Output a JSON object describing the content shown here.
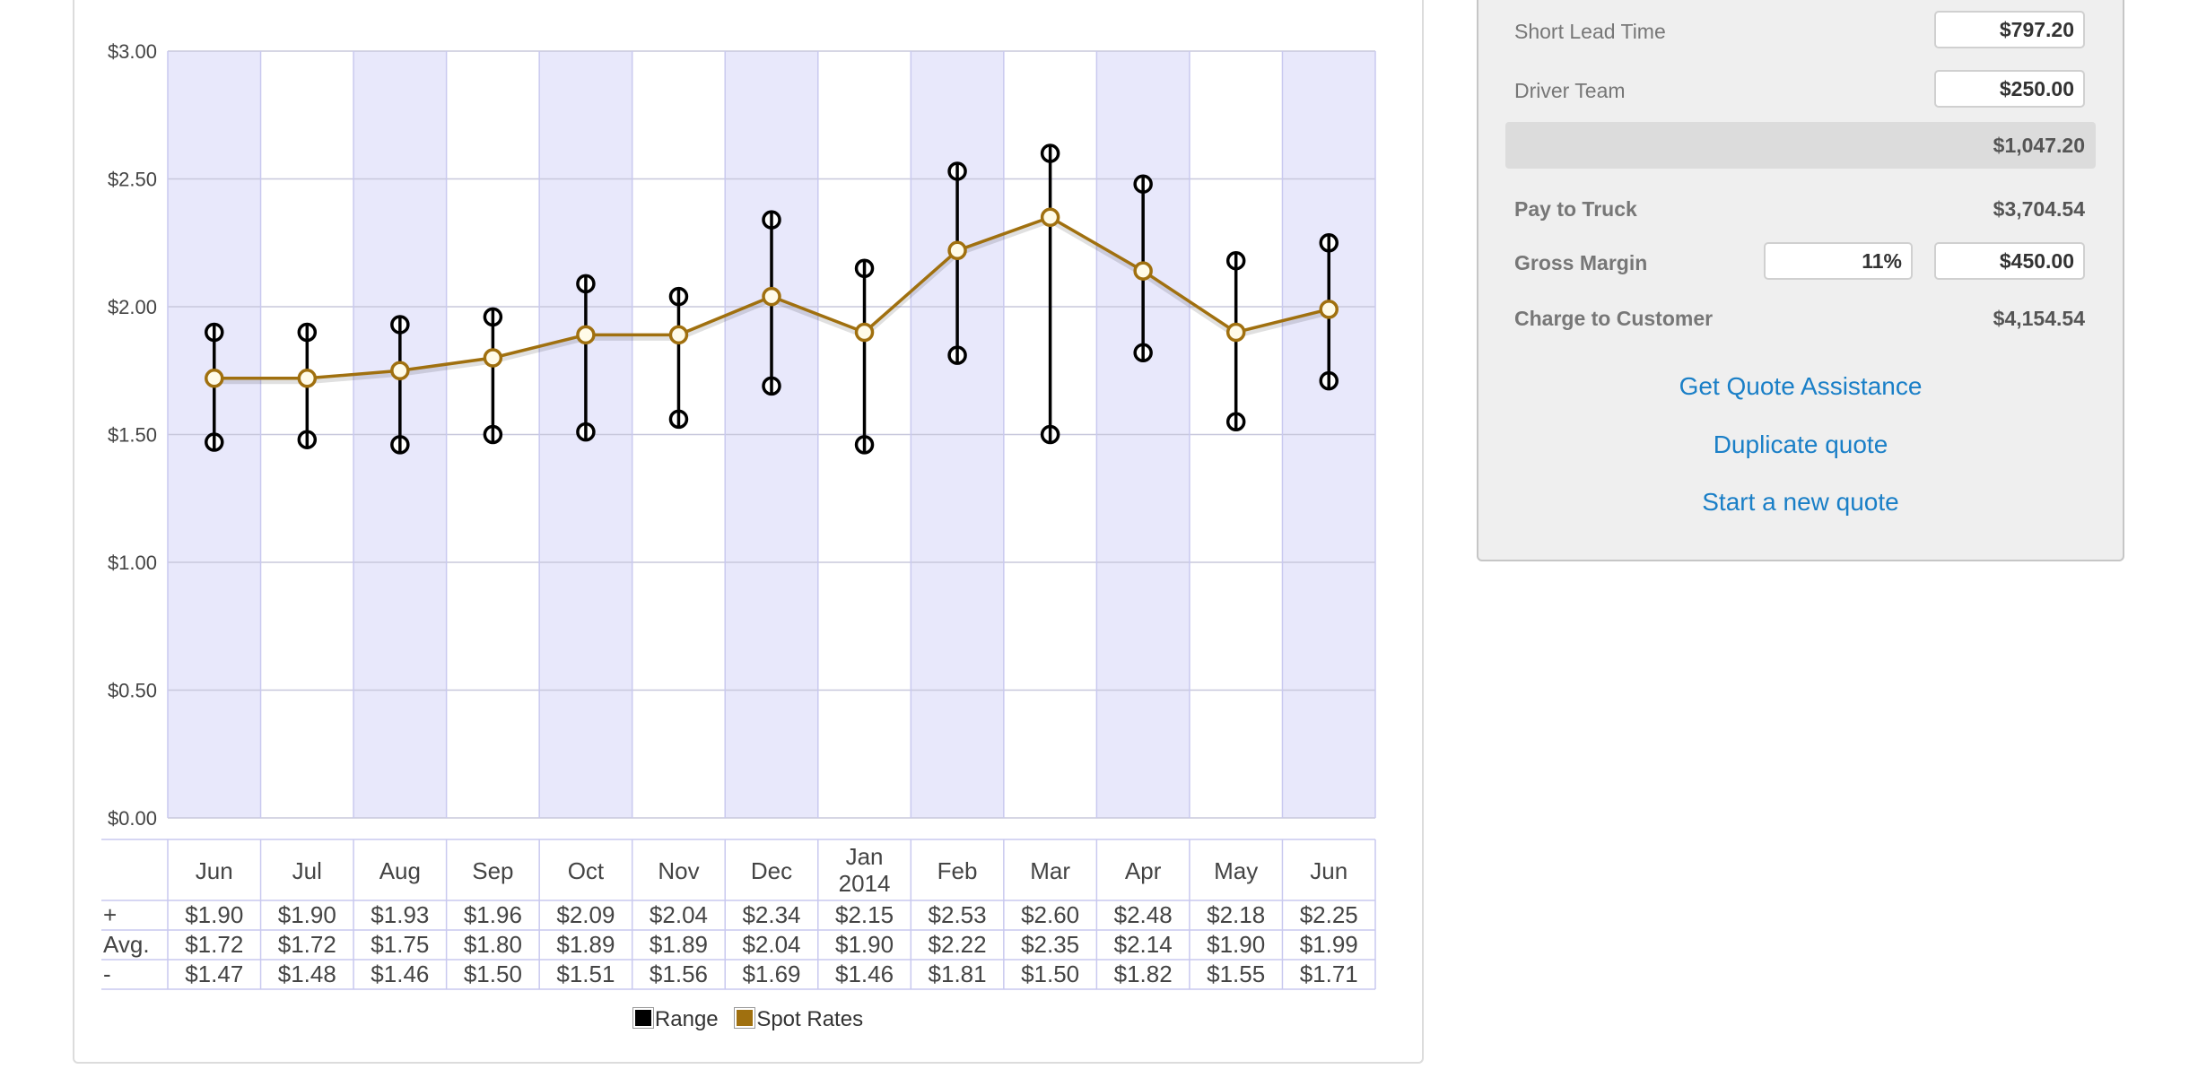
{
  "chart_data": {
    "type": "line",
    "categories": [
      "Jun",
      "Jul",
      "Aug",
      "Sep",
      "Oct",
      "Nov",
      "Dec",
      "Jan 2014",
      "Feb",
      "Mar",
      "Apr",
      "May",
      "Jun"
    ],
    "series": [
      {
        "name": "Range",
        "high": [
          1.9,
          1.9,
          1.93,
          1.96,
          2.09,
          2.04,
          2.34,
          2.15,
          2.53,
          2.6,
          2.48,
          2.18,
          2.25
        ],
        "low": [
          1.47,
          1.48,
          1.46,
          1.5,
          1.51,
          1.56,
          1.69,
          1.46,
          1.81,
          1.5,
          1.82,
          1.55,
          1.71
        ]
      },
      {
        "name": "Spot Rates",
        "values": [
          1.72,
          1.72,
          1.75,
          1.8,
          1.89,
          1.89,
          2.04,
          1.9,
          2.22,
          2.35,
          2.14,
          1.9,
          1.99
        ]
      }
    ],
    "ylim": [
      0,
      3
    ],
    "yticks": [
      "$0.00",
      "$0.50",
      "$1.00",
      "$1.50",
      "$2.00",
      "$2.50",
      "$3.00"
    ],
    "xlabel": "",
    "ylabel": "",
    "grid": true,
    "legend_position": "bottom",
    "table": {
      "row_labels": [
        "+",
        "Avg.",
        "-"
      ],
      "plus": [
        "$1.90",
        "$1.90",
        "$1.93",
        "$1.96",
        "$2.09",
        "$2.04",
        "$2.34",
        "$2.15",
        "$2.53",
        "$2.60",
        "$2.48",
        "$2.18",
        "$2.25"
      ],
      "avg": [
        "$1.72",
        "$1.72",
        "$1.75",
        "$1.80",
        "$1.89",
        "$1.89",
        "$2.04",
        "$1.90",
        "$2.22",
        "$2.35",
        "$2.14",
        "$1.90",
        "$1.99"
      ],
      "minus": [
        "$1.47",
        "$1.48",
        "$1.46",
        "$1.50",
        "$1.51",
        "$1.56",
        "$1.69",
        "$1.46",
        "$1.81",
        "$1.50",
        "$1.82",
        "$1.55",
        "$1.71"
      ]
    },
    "colors": {
      "range": "#000000",
      "spot": "#a0700f",
      "band": "#e8e8fb",
      "grid": "#c8c8dc",
      "cell_border": "#c9c9ef"
    }
  },
  "legend": {
    "range_label": "Range",
    "spot_label": "Spot Rates"
  },
  "quote": {
    "short_lead_time_label": "Short Lead Time",
    "short_lead_time_value": "$797.20",
    "driver_team_label": "Driver Team",
    "driver_team_value": "$250.00",
    "subtotal": "$1,047.20",
    "pay_to_truck_label": "Pay to Truck",
    "pay_to_truck_value": "$3,704.54",
    "gross_margin_label": "Gross Margin",
    "gross_margin_percent": "11%",
    "gross_margin_value": "$450.00",
    "charge_label": "Charge to Customer",
    "charge_value": "$4,154.54",
    "link_assistance": "Get Quote Assistance",
    "link_duplicate": "Duplicate quote",
    "link_new": "Start a new quote"
  }
}
